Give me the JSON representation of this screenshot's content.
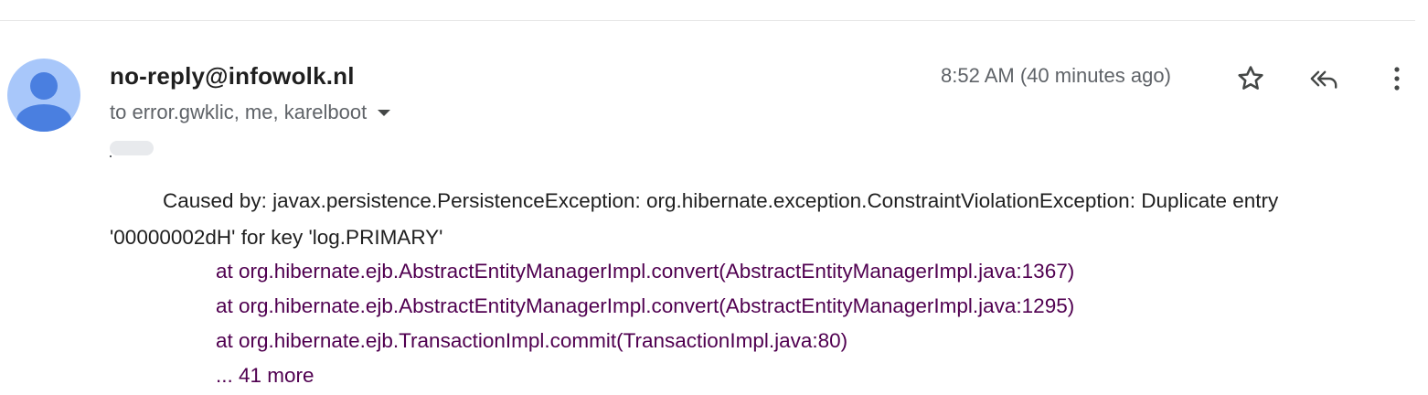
{
  "email": {
    "sender": "no-reply@infowolk.nl",
    "recipients": "to error.gwklic, me, karelboot",
    "timestamp": "8:52 AM (40 minutes ago)",
    "body_line_1": "Caused by: javax.persistence.PersistenceException: org.hibernate.exception.ConstraintViolationException: Duplicate entry '00000002dH' for key 'log.PRIMARY'",
    "stack": [
      "at org.hibernate.ejb.AbstractEntityManagerImpl.convert(AbstractEntityManagerImpl.java:1367)",
      "at org.hibernate.ejb.AbstractEntityManagerImpl.convert(AbstractEntityManagerImpl.java:1295)",
      "at org.hibernate.ejb.TransactionImpl.commit(TransactionImpl.java:80)",
      "... 41 more"
    ]
  },
  "icons": {
    "avatar": "person-icon",
    "star": "star-icon",
    "reply_all": "reply-all-icon",
    "more": "more-vert-icon",
    "recipients_toggle": "caret-down-icon"
  },
  "colors": {
    "sender": "#1f1f1f",
    "meta": "#5f6368",
    "quoted_text": "#500050",
    "avatar_bg": "#a8c7fa",
    "avatar_fg": "#4a7fe0"
  }
}
